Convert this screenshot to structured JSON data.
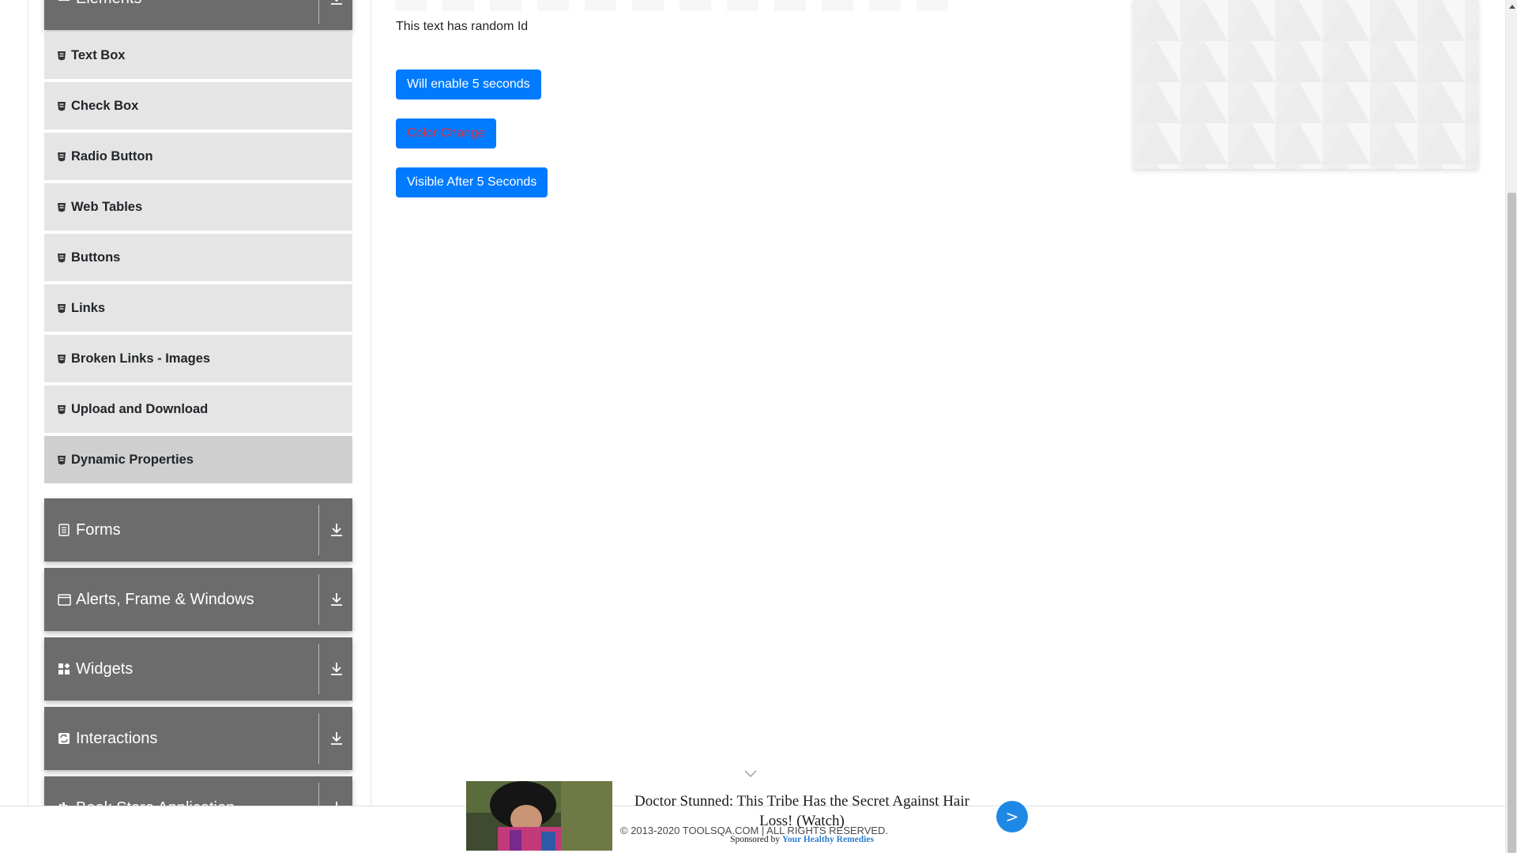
{
  "sidebar": {
    "elements_group": {
      "label": "Elements"
    },
    "items": [
      {
        "label": "Text Box"
      },
      {
        "label": "Check Box"
      },
      {
        "label": "Radio Button"
      },
      {
        "label": "Web Tables"
      },
      {
        "label": "Buttons"
      },
      {
        "label": "Links"
      },
      {
        "label": "Broken Links - Images"
      },
      {
        "label": "Upload and Download"
      },
      {
        "label": "Dynamic Properties"
      }
    ],
    "active_item": "Dynamic Properties",
    "groups": [
      {
        "label": "Forms",
        "icon": "document-icon"
      },
      {
        "label": "Alerts, Frame & Windows",
        "icon": "window-icon"
      },
      {
        "label": "Widgets",
        "icon": "widgets-icon"
      },
      {
        "label": "Interactions",
        "icon": "interactions-icon"
      },
      {
        "label": "Book Store Application",
        "icon": "book-store-icon"
      }
    ]
  },
  "main": {
    "random_id_text": "This text has random Id",
    "enable_button_label": "Will enable 5 seconds",
    "color_change_button_label": "Color Change",
    "visible_after_button_label": "Visible After 5 Seconds"
  },
  "footer": {
    "copyright": "© 2013-2020 TOOLSQA.COM | ALL RIGHTS RESERVED."
  },
  "sponsored_ad": {
    "headline": "Doctor Stunned: This Tribe Has the Secret Against Hair Loss! (Watch)",
    "sponsored_prefix": "Sponsored by",
    "sponsor_name": "Your Healthy Remedies",
    "next_label": ">"
  },
  "colors": {
    "primary": "#007bff",
    "sidebar_group": "#6c6c6c",
    "sidebar_item": "#e5e5e5",
    "sidebar_item_active": "#cfcfcf",
    "color_change_text": "#dc3545"
  }
}
